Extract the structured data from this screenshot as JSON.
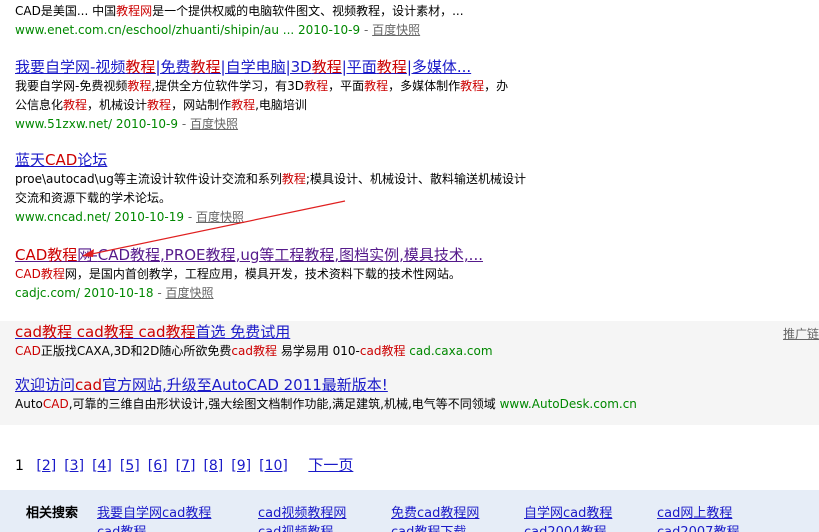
{
  "results": [
    {
      "title_parts": [],
      "desc_lines": [
        [
          {
            "t": "CAD是美国... 中国"
          },
          {
            "t": "教程网",
            "h": true
          },
          {
            "t": "是一个提供权威的电脑软件图文、视频教程，设计素材，..."
          }
        ]
      ],
      "url": "www.enet.com.cn/eschool/zhuanti/shipin/au ... 2010-10-9",
      "cache": "百度快照"
    },
    {
      "title_parts": [
        {
          "t": "我要自学网-视频"
        },
        {
          "t": "教程",
          "h": true
        },
        {
          "t": "|免费"
        },
        {
          "t": "教程",
          "h": true
        },
        {
          "t": "|自学电脑|3D"
        },
        {
          "t": "教程",
          "h": true
        },
        {
          "t": "|平面"
        },
        {
          "t": "教程",
          "h": true
        },
        {
          "t": "|多媒体..."
        }
      ],
      "desc_lines": [
        [
          {
            "t": "我要自学网-免费视频"
          },
          {
            "t": "教程",
            "h": true
          },
          {
            "t": ",提供全方位软件学习，有3D"
          },
          {
            "t": "教程",
            "h": true
          },
          {
            "t": "，平面"
          },
          {
            "t": "教程",
            "h": true
          },
          {
            "t": "，多媒体制作"
          },
          {
            "t": "教程",
            "h": true
          },
          {
            "t": "，办"
          }
        ],
        [
          {
            "t": "公信息化"
          },
          {
            "t": "教程",
            "h": true
          },
          {
            "t": "，机械设计"
          },
          {
            "t": "教程",
            "h": true
          },
          {
            "t": "，网站制作"
          },
          {
            "t": "教程",
            "h": true
          },
          {
            "t": ",电脑培训"
          }
        ]
      ],
      "url": "www.51zxw.net/ 2010-10-9",
      "cache": "百度快照"
    },
    {
      "title_parts": [
        {
          "t": "蓝天"
        },
        {
          "t": "CAD",
          "h": true
        },
        {
          "t": "论坛"
        }
      ],
      "desc_lines": [
        [
          {
            "t": "proe\\autocad\\ug等主流设计软件设计交流和系列"
          },
          {
            "t": "教程",
            "h": true
          },
          {
            "t": ";模具设计、机械设计、散料输送机械设计"
          }
        ],
        [
          {
            "t": "交流和资源下载的学术论坛。"
          }
        ]
      ],
      "url": "www.cncad.net/ 2010-10-19",
      "cache": "百度快照"
    },
    {
      "title_parts": [
        {
          "t": "CAD教程",
          "h": true
        },
        {
          "t": "网-"
        },
        {
          "t": "CAD教程",
          "h": false
        },
        {
          "t": ",PROE"
        },
        {
          "t": "教程",
          "h": false
        },
        {
          "t": ",ug等工程"
        },
        {
          "t": "教程",
          "h": false
        },
        {
          "t": ",图档实例,模具技术,..."
        }
      ],
      "desc_lines": [
        [
          {
            "t": "CAD教程",
            "h": true
          },
          {
            "t": "网"
          },
          {
            "t": "，是国内首创教学，工程应用，模具开发，技术资料下载的技术性网站。"
          }
        ]
      ],
      "url": "cadjc.com/ 2010-10-18",
      "cache": "百度快照"
    }
  ],
  "ads": [
    {
      "title_parts": [
        {
          "t": "cad教程",
          "h": true
        },
        {
          "t": "  "
        },
        {
          "t": "cad教程",
          "h": true
        },
        {
          "t": "  "
        },
        {
          "t": "cad教程",
          "h": true
        },
        {
          "t": "首选  免费试用"
        }
      ],
      "desc_parts": [
        {
          "t": "CAD",
          "h": true
        },
        {
          "t": "正版找CAXA,3D和2D随心所欲免费"
        },
        {
          "t": "cad教程",
          "h": true
        },
        {
          "t": "  易学易用  010-"
        },
        {
          "t": "cad教程",
          "h": true
        },
        {
          "t": "  "
        }
      ],
      "url": "cad.caxa.com"
    },
    {
      "title_parts": [
        {
          "t": "欢迎访问"
        },
        {
          "t": "cad",
          "h": true
        },
        {
          "t": "官方网站,升级至AutoCAD 2011最新版本!"
        }
      ],
      "desc_parts": [
        {
          "t": "Auto"
        },
        {
          "t": "CAD",
          "h": true
        },
        {
          "t": ",可靠的三维自由形状设计,强大绘图文档制作功能,满足建筑,机械,电气等不同领域  "
        }
      ],
      "url": "www.AutoDesk.com.cn"
    }
  ],
  "ad_tag": "推广链",
  "pager": {
    "current": "1",
    "pages": [
      "[2]",
      "[3]",
      "[4]",
      "[5]",
      "[6]",
      "[7]",
      "[8]",
      "[9]",
      "[10]"
    ],
    "next": "下一页"
  },
  "related": {
    "label": "相关搜索",
    "row1": [
      "我要自学网cad教程",
      "cad视频教程网",
      "免费cad教程网",
      "自学网cad教程",
      "cad网上教程"
    ],
    "row2": [
      "cad教程",
      "cad视频教程",
      "cad教程下载",
      "cad2004教程",
      "cad2007教程"
    ]
  },
  "colors": {
    "link": "#1a1ac8",
    "highlight": "#c00",
    "url": "#080",
    "annotation": "#e02020"
  }
}
